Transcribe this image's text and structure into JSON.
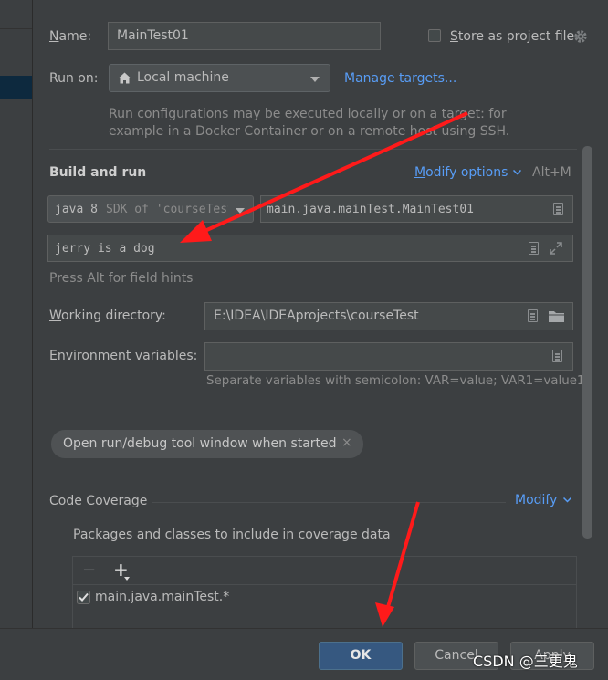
{
  "name": {
    "label": "Name:",
    "value": "MainTest01"
  },
  "store_as_project_file": {
    "label": "Store as project file",
    "checked": false
  },
  "run_on": {
    "label": "Run on:",
    "value": "Local machine",
    "manage_targets": "Manage targets..."
  },
  "run_on_hint": [
    "Run configurations may be executed locally or on a target: for",
    "example in a Docker Container or on a remote host using SSH."
  ],
  "build_and_run": {
    "title": "Build and run",
    "modify_options": "Modify options",
    "shortcut": "Alt+M",
    "jdk_value": "java 8",
    "jdk_hint": "SDK of 'courseTest",
    "main_class": "main.java.mainTest.MainTest01",
    "program_args": "jerry is a dog",
    "field_hint": "Press Alt for field hints"
  },
  "working_directory": {
    "label": "Working directory:",
    "value": "E:\\IDEA\\IDEAprojects\\courseTest"
  },
  "environment_variables": {
    "label": "Environment variables:",
    "value": "",
    "hint": "Separate variables with semicolon: VAR=value; VAR1=value1"
  },
  "chip": {
    "label": "Open run/debug tool window when started"
  },
  "code_coverage": {
    "title": "Code Coverage",
    "modify": "Modify",
    "packages_label": "Packages and classes to include in coverage data",
    "toolbar": {
      "remove": "−",
      "add": "+"
    },
    "items": [
      {
        "label": "main.java.mainTest.*",
        "checked": true
      }
    ]
  },
  "buttons": {
    "ok": "OK",
    "cancel": "Cancel",
    "apply": "Apply"
  },
  "watermark": "CSDN @三更鬼",
  "colors": {
    "background": "#3c3f41",
    "field": "#45494a",
    "link": "#589df6",
    "ok_button": "#365880",
    "annotation_arrow": "#ff1a1a"
  }
}
